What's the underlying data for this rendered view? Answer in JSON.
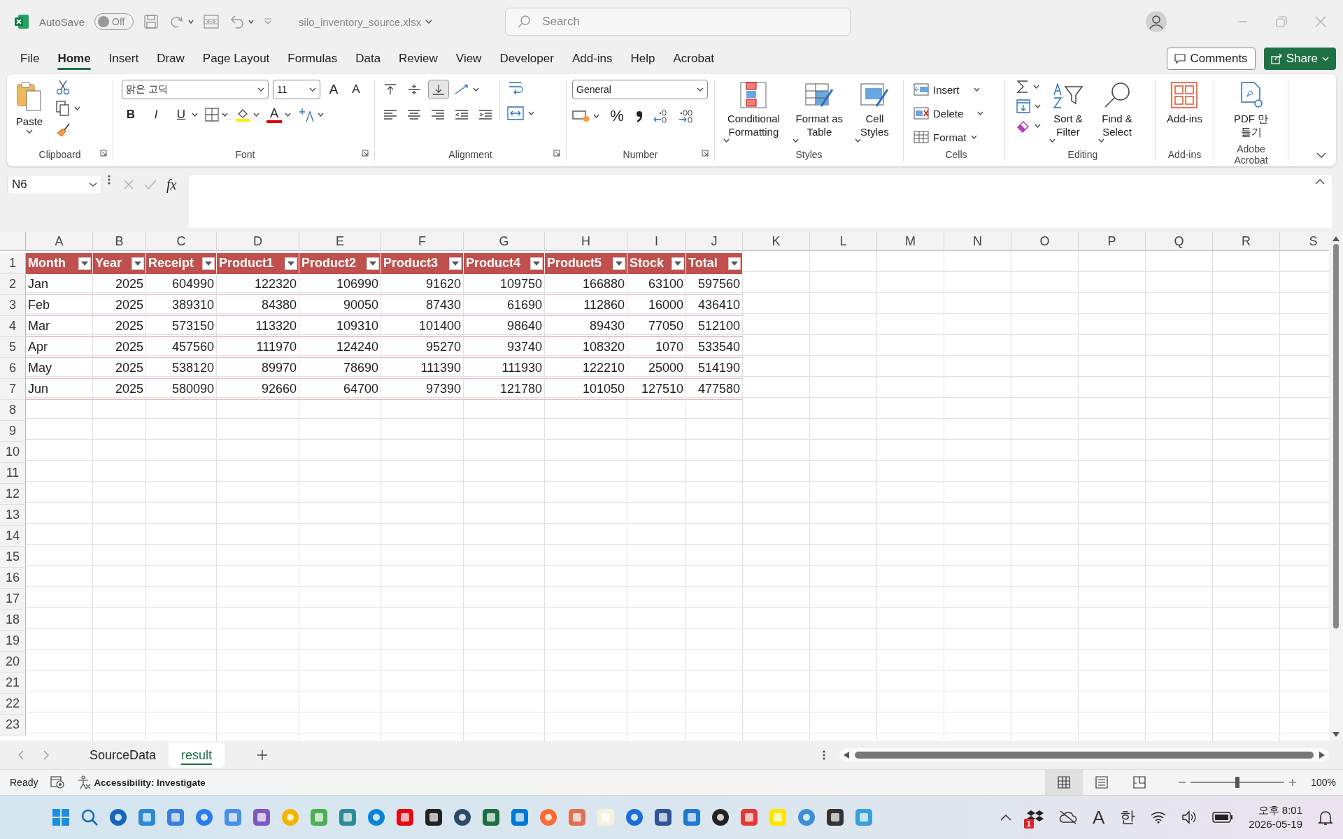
{
  "title_bar": {
    "autosave": {
      "label": "AutoSave",
      "on": false,
      "state": "Off"
    },
    "filename": "silo_inventory_source.xlsx",
    "search": {
      "placeholder": "Search"
    }
  },
  "menu_tabs": [
    {
      "label": "File",
      "selected": false
    },
    {
      "label": "Home",
      "selected": true
    },
    {
      "label": "Insert",
      "selected": false
    },
    {
      "label": "Draw",
      "selected": false
    },
    {
      "label": "Page Layout",
      "selected": false
    },
    {
      "label": "Formulas",
      "selected": false
    },
    {
      "label": "Data",
      "selected": false
    },
    {
      "label": "Review",
      "selected": false
    },
    {
      "label": "View",
      "selected": false
    },
    {
      "label": "Developer",
      "selected": false
    },
    {
      "label": "Add-ins",
      "selected": false
    },
    {
      "label": "Help",
      "selected": false
    },
    {
      "label": "Acrobat",
      "selected": false
    }
  ],
  "comments_button": "Comments",
  "share_button": "Share",
  "ribbon": {
    "clipboard": {
      "label": "Clipboard",
      "paste": "Paste"
    },
    "font": {
      "label": "Font",
      "font_name": "맑은 고딕",
      "font_size": "11",
      "grow": "A",
      "shrink": "A",
      "bold": "B",
      "italic": "I",
      "underline": "U",
      "font_color": "A"
    },
    "alignment": {
      "label": "Alignment"
    },
    "number": {
      "label": "Number",
      "format": "General",
      "percent": "%"
    },
    "styles": {
      "label": "Styles",
      "conditional": "Conditional Formatting",
      "format_table": "Format as Table",
      "cell_styles": "Cell Styles"
    },
    "cells": {
      "label": "Cells",
      "insert": "Insert",
      "delete": "Delete",
      "format": "Format"
    },
    "editing": {
      "label": "Editing",
      "sort": "Sort & Filter",
      "find": "Find & Select"
    },
    "addins": {
      "label": "Add-ins",
      "button": "Add-ins"
    },
    "acrobat": {
      "label": "Adobe Acrobat",
      "button": "PDF 만들기"
    }
  },
  "formula_bar": {
    "name_box": "N6",
    "fx": "fx"
  },
  "sheet": {
    "column_headers": [
      "A",
      "B",
      "C",
      "D",
      "E",
      "F",
      "G",
      "H",
      "I",
      "J",
      "K",
      "L",
      "M",
      "N",
      "O",
      "P",
      "Q",
      "R",
      "S"
    ],
    "row_numbers": [
      "1",
      "2",
      "3",
      "4",
      "5",
      "6",
      "7",
      "8",
      "9",
      "10",
      "11",
      "12",
      "13",
      "14",
      "15",
      "16",
      "17",
      "18",
      "19",
      "20",
      "21",
      "22",
      "23"
    ],
    "table": {
      "columns": [
        {
          "label": "Month",
          "kind": "text"
        },
        {
          "label": "Year",
          "kind": "number"
        },
        {
          "label": "Receipt",
          "kind": "number"
        },
        {
          "label": "Product1",
          "kind": "number"
        },
        {
          "label": "Product2",
          "kind": "number"
        },
        {
          "label": "Product3",
          "kind": "number"
        },
        {
          "label": "Product4",
          "kind": "number"
        },
        {
          "label": "Product5",
          "kind": "number"
        },
        {
          "label": "Stock",
          "kind": "number"
        },
        {
          "label": "Total",
          "kind": "number"
        }
      ],
      "rows": [
        [
          "Jan",
          "2025",
          "604990",
          "122320",
          "106990",
          "91620",
          "109750",
          "166880",
          "63100",
          "597560"
        ],
        [
          "Feb",
          "2025",
          "389310",
          "84380",
          "90050",
          "87430",
          "61690",
          "112860",
          "16000",
          "436410"
        ],
        [
          "Mar",
          "2025",
          "573150",
          "113320",
          "109310",
          "101400",
          "98640",
          "89430",
          "77050",
          "512100"
        ],
        [
          "Apr",
          "2025",
          "457560",
          "111970",
          "124240",
          "95270",
          "93740",
          "108320",
          "1070",
          "533540"
        ],
        [
          "May",
          "2025",
          "538120",
          "89970",
          "78690",
          "111390",
          "111930",
          "122210",
          "25000",
          "514190"
        ],
        [
          "Jun",
          "2025",
          "580090",
          "92660",
          "64700",
          "97390",
          "121780",
          "101050",
          "127510",
          "477580"
        ]
      ]
    }
  },
  "sheet_tabs": [
    {
      "label": "SourceData",
      "selected": false
    },
    {
      "label": "result",
      "selected": true
    }
  ],
  "status_bar": {
    "mode": "Ready",
    "accessibility": "Accessibility: Investigate",
    "zoom": {
      "level": 0.5,
      "reading": "100%"
    }
  },
  "taskbar": {
    "dropbox_badge": "1",
    "ime_font": "A",
    "ime": "한",
    "time": "오후 8:01",
    "date": "2026-05-19"
  }
}
